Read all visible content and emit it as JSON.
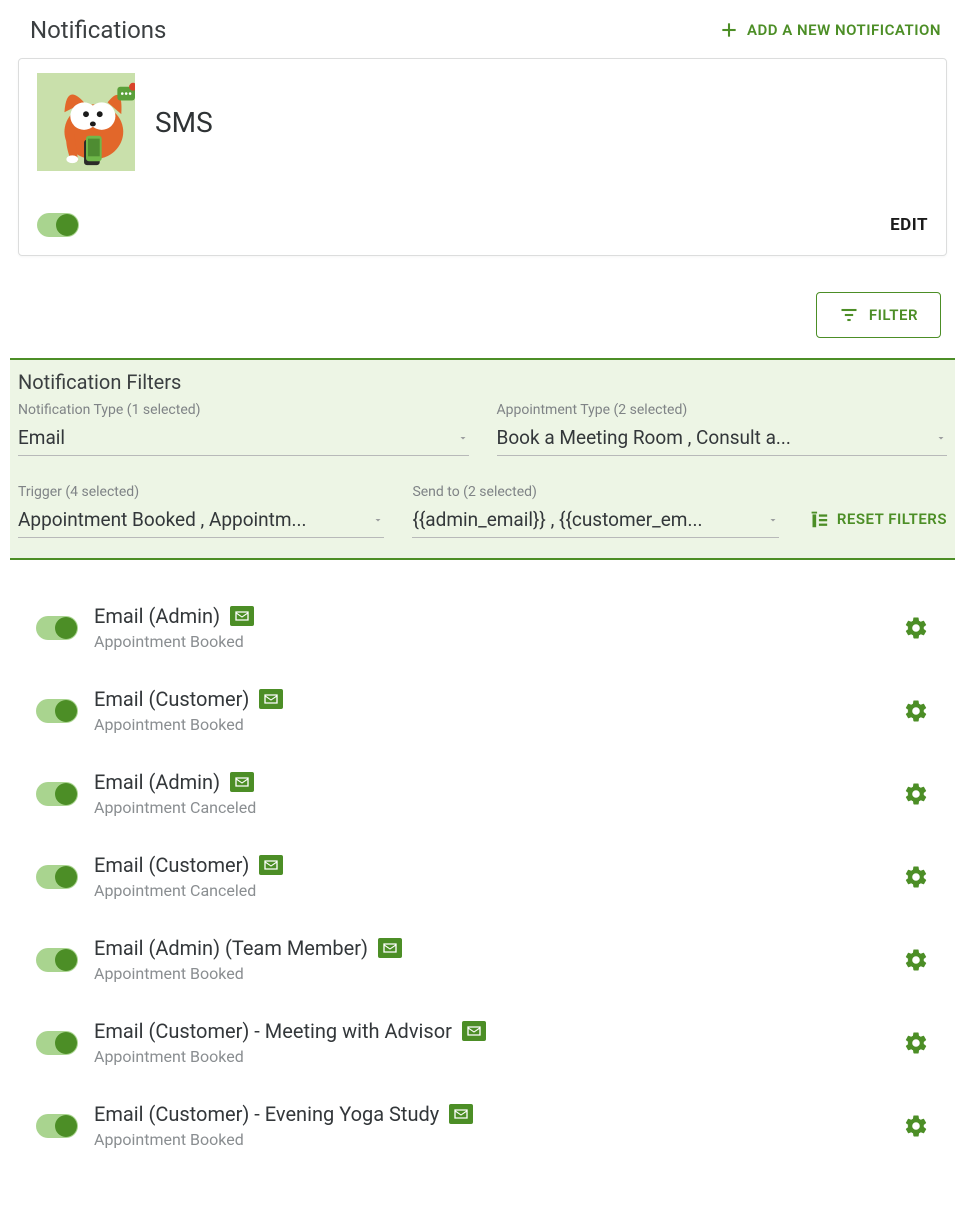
{
  "header": {
    "title": "Notifications",
    "add_button": "ADD A NEW NOTIFICATION"
  },
  "sms_card": {
    "title": "SMS",
    "edit_label": "EDIT"
  },
  "filter_button": "FILTER",
  "filters_panel": {
    "title": "Notification Filters",
    "fields": {
      "notification_type": {
        "label": "Notification Type (1 selected)",
        "value": "Email"
      },
      "appointment_type": {
        "label": "Appointment Type (2 selected)",
        "value": "Book a Meeting Room , Consult a..."
      },
      "trigger": {
        "label": "Trigger (4 selected)",
        "value": "Appointment Booked , Appointm..."
      },
      "send_to": {
        "label": "Send to (2 selected)",
        "value": "{{admin_email}} , {{customer_em..."
      }
    },
    "reset_label": "RESET FILTERS"
  },
  "notifications": [
    {
      "title": "Email (Admin)",
      "subtitle": "Appointment Booked"
    },
    {
      "title": "Email (Customer)",
      "subtitle": "Appointment Booked"
    },
    {
      "title": "Email (Admin)",
      "subtitle": "Appointment Canceled"
    },
    {
      "title": "Email (Customer)",
      "subtitle": "Appointment Canceled"
    },
    {
      "title": "Email (Admin) (Team Member)",
      "subtitle": "Appointment Booked"
    },
    {
      "title": "Email (Customer) - Meeting with Advisor",
      "subtitle": "Appointment Booked"
    },
    {
      "title": "Email (Customer) - Evening Yoga Study",
      "subtitle": "Appointment Booked"
    }
  ]
}
